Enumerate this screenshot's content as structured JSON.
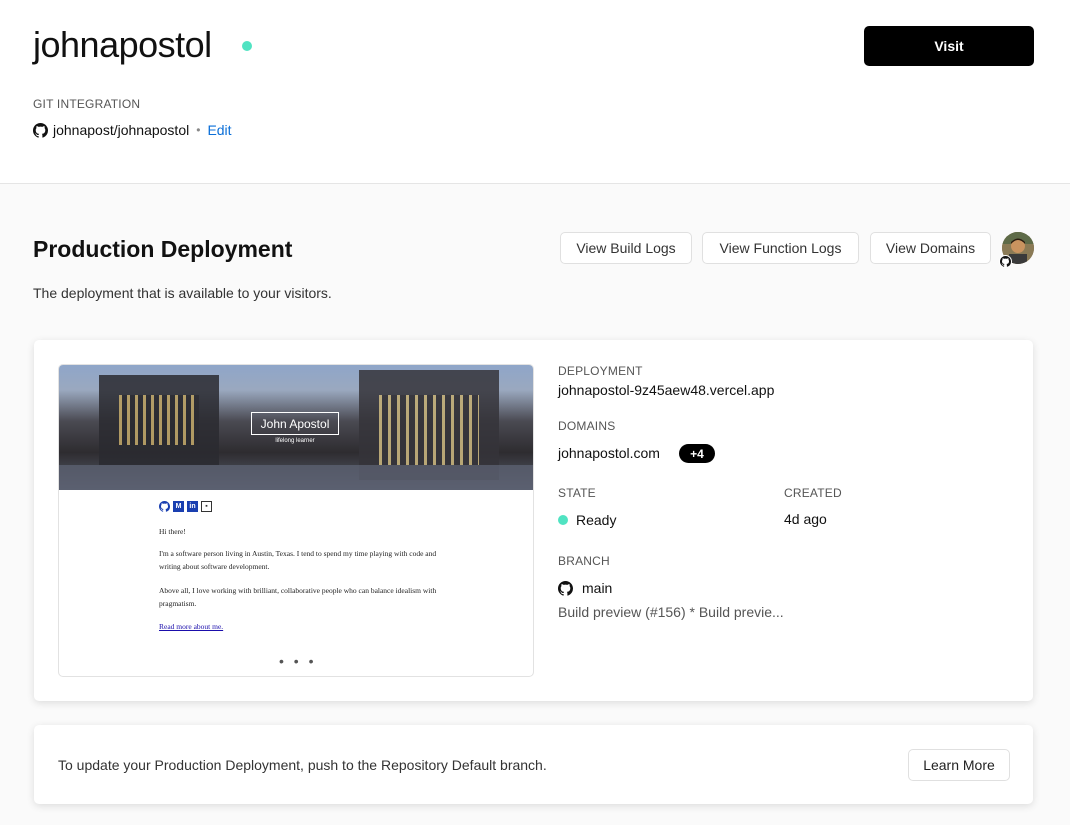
{
  "header": {
    "project_name": "johnapostol",
    "visit_label": "Visit",
    "git_integration_label": "GIT INTEGRATION",
    "repo": "johnapost/johnapostol",
    "edit_label": "Edit"
  },
  "production": {
    "title": "Production Deployment",
    "subtitle": "The deployment that is available to your visitors.",
    "buttons": {
      "build_logs": "View Build Logs",
      "function_logs": "View Function Logs",
      "domains": "View Domains"
    }
  },
  "preview": {
    "name": "John Apostol",
    "tagline": "lifelong learner",
    "greeting": "Hi there!",
    "para1": "I'm a software person living in Austin, Texas. I tend to spend my time playing with code and writing about software development.",
    "para2": "Above all, I love working with brilliant, collaborative people who can balance idealism with pragmatism.",
    "link": "Read more about me.",
    "dots": "• • •"
  },
  "deployment": {
    "deployment_label": "DEPLOYMENT",
    "deployment_url": "johnapostol-9z45aew48.vercel.app",
    "domains_label": "DOMAINS",
    "domain": "johnapostol.com",
    "domain_extra": "+4",
    "state_label": "STATE",
    "state_value": "Ready",
    "created_label": "CREATED",
    "created_value": "4d ago",
    "branch_label": "BRANCH",
    "branch_value": "main",
    "commit_message": "Build preview (#156) * Build previe..."
  },
  "footer_card": {
    "text": "To update your Production Deployment, push to the Repository Default branch.",
    "learn_more": "Learn More"
  },
  "colors": {
    "ready": "#50e3c2",
    "link": "#0b6fd8",
    "primary": "#000000"
  }
}
